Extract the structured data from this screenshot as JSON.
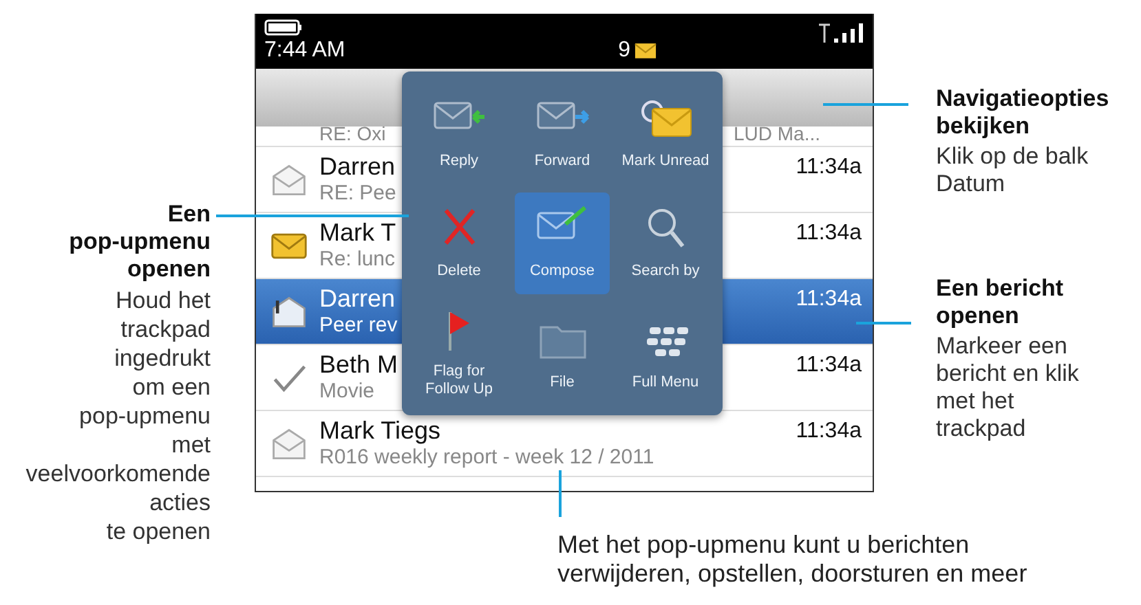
{
  "status_bar": {
    "time": "7:44 AM",
    "unread_count": "9"
  },
  "partial_row": {
    "subject": "RE: Oxi",
    "preview": "LUD Ma..."
  },
  "messages": [
    {
      "sender": "Darren",
      "subject": "RE: Pee",
      "time": "11:34a",
      "kind": "read",
      "selected": false
    },
    {
      "sender": "Mark T",
      "subject": "Re: lunc",
      "time": "11:34a",
      "kind": "unread",
      "selected": false
    },
    {
      "sender": "Darren",
      "subject": "Peer rev",
      "time": "11:34a",
      "kind": "attachment",
      "selected": true
    },
    {
      "sender": "Beth M",
      "subject": "Movie",
      "time": "11:34a",
      "kind": "sent",
      "selected": false
    },
    {
      "sender": "Mark Tiegs",
      "subject": "R016 weekly report - week 12 / 2011",
      "time": "11:34a",
      "kind": "read",
      "selected": false
    }
  ],
  "popup_menu": [
    {
      "label": "Reply",
      "kind": "reply",
      "selected": false
    },
    {
      "label": "Forward",
      "kind": "forward",
      "selected": false
    },
    {
      "label": "Mark Unread",
      "kind": "unread",
      "selected": false
    },
    {
      "label": "Delete",
      "kind": "delete",
      "selected": false
    },
    {
      "label": "Compose",
      "kind": "compose",
      "selected": true
    },
    {
      "label": "Search by",
      "kind": "search",
      "selected": false
    },
    {
      "label": "Flag for Follow Up",
      "kind": "flag",
      "selected": false
    },
    {
      "label": "File",
      "kind": "folder",
      "selected": false
    },
    {
      "label": "Full Menu",
      "kind": "full",
      "selected": false
    }
  ],
  "callout_popup": {
    "title": "Een\npop-upmenu\nopenen",
    "body": "Houd het\ntrackpad\ningedrukt\nom een\npop-upmenu\nmet\nveelvoorkomende\nacties\nte openen"
  },
  "callout_navigation": {
    "title": "Navigatieopties\nbekijken",
    "body": "Klik op de balk\nDatum"
  },
  "callout_open": {
    "title": "Een bericht\nopenen",
    "body": "Markeer een\nbericht en klik\nmet het\ntrackpad"
  },
  "caption": "Met het pop-upmenu kunt u berichten\nverwijderen, opstellen, doorsturen en meer"
}
